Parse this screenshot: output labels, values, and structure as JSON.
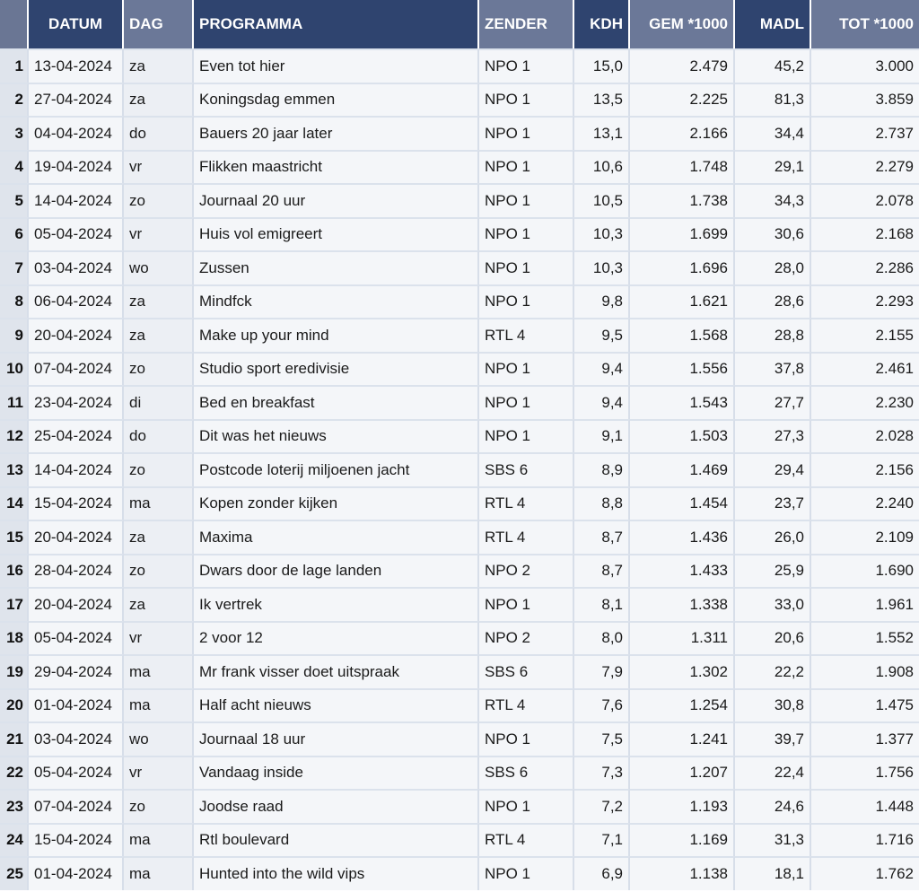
{
  "headers": {
    "rank": "",
    "datum": "DATUM",
    "dag": "DAG",
    "programma": "PROGRAMMA",
    "zender": "ZENDER",
    "kdh": "KDH",
    "gem": "GEM *1000",
    "madl": "MADL",
    "tot": "TOT *1000"
  },
  "rows": [
    {
      "rank": "1",
      "datum": "13-04-2024",
      "dag": "za",
      "programma": "Even tot hier",
      "zender": "NPO 1",
      "kdh": "15,0",
      "gem": "2.479",
      "madl": "45,2",
      "tot": "3.000"
    },
    {
      "rank": "2",
      "datum": "27-04-2024",
      "dag": "za",
      "programma": "Koningsdag emmen",
      "zender": "NPO 1",
      "kdh": "13,5",
      "gem": "2.225",
      "madl": "81,3",
      "tot": "3.859"
    },
    {
      "rank": "3",
      "datum": "04-04-2024",
      "dag": "do",
      "programma": "Bauers 20 jaar later",
      "zender": "NPO 1",
      "kdh": "13,1",
      "gem": "2.166",
      "madl": "34,4",
      "tot": "2.737"
    },
    {
      "rank": "4",
      "datum": "19-04-2024",
      "dag": "vr",
      "programma": "Flikken maastricht",
      "zender": "NPO 1",
      "kdh": "10,6",
      "gem": "1.748",
      "madl": "29,1",
      "tot": "2.279"
    },
    {
      "rank": "5",
      "datum": "14-04-2024",
      "dag": "zo",
      "programma": "Journaal 20 uur",
      "zender": "NPO 1",
      "kdh": "10,5",
      "gem": "1.738",
      "madl": "34,3",
      "tot": "2.078"
    },
    {
      "rank": "6",
      "datum": "05-04-2024",
      "dag": "vr",
      "programma": "Huis vol emigreert",
      "zender": "NPO 1",
      "kdh": "10,3",
      "gem": "1.699",
      "madl": "30,6",
      "tot": "2.168"
    },
    {
      "rank": "7",
      "datum": "03-04-2024",
      "dag": "wo",
      "programma": "Zussen",
      "zender": "NPO 1",
      "kdh": "10,3",
      "gem": "1.696",
      "madl": "28,0",
      "tot": "2.286"
    },
    {
      "rank": "8",
      "datum": "06-04-2024",
      "dag": "za",
      "programma": "Mindfck",
      "zender": "NPO 1",
      "kdh": "9,8",
      "gem": "1.621",
      "madl": "28,6",
      "tot": "2.293"
    },
    {
      "rank": "9",
      "datum": "20-04-2024",
      "dag": "za",
      "programma": "Make up your mind",
      "zender": "RTL 4",
      "kdh": "9,5",
      "gem": "1.568",
      "madl": "28,8",
      "tot": "2.155"
    },
    {
      "rank": "10",
      "datum": "07-04-2024",
      "dag": "zo",
      "programma": "Studio sport eredivisie",
      "zender": "NPO 1",
      "kdh": "9,4",
      "gem": "1.556",
      "madl": "37,8",
      "tot": "2.461"
    },
    {
      "rank": "11",
      "datum": "23-04-2024",
      "dag": "di",
      "programma": "Bed en breakfast",
      "zender": "NPO 1",
      "kdh": "9,4",
      "gem": "1.543",
      "madl": "27,7",
      "tot": "2.230"
    },
    {
      "rank": "12",
      "datum": "25-04-2024",
      "dag": "do",
      "programma": "Dit was het nieuws",
      "zender": "NPO 1",
      "kdh": "9,1",
      "gem": "1.503",
      "madl": "27,3",
      "tot": "2.028"
    },
    {
      "rank": "13",
      "datum": "14-04-2024",
      "dag": "zo",
      "programma": "Postcode loterij miljoenen jacht",
      "zender": "SBS 6",
      "kdh": "8,9",
      "gem": "1.469",
      "madl": "29,4",
      "tot": "2.156"
    },
    {
      "rank": "14",
      "datum": "15-04-2024",
      "dag": "ma",
      "programma": "Kopen zonder kijken",
      "zender": "RTL 4",
      "kdh": "8,8",
      "gem": "1.454",
      "madl": "23,7",
      "tot": "2.240"
    },
    {
      "rank": "15",
      "datum": "20-04-2024",
      "dag": "za",
      "programma": "Maxima",
      "zender": "RTL 4",
      "kdh": "8,7",
      "gem": "1.436",
      "madl": "26,0",
      "tot": "2.109"
    },
    {
      "rank": "16",
      "datum": "28-04-2024",
      "dag": "zo",
      "programma": "Dwars door de lage landen",
      "zender": "NPO 2",
      "kdh": "8,7",
      "gem": "1.433",
      "madl": "25,9",
      "tot": "1.690"
    },
    {
      "rank": "17",
      "datum": "20-04-2024",
      "dag": "za",
      "programma": "Ik vertrek",
      "zender": "NPO 1",
      "kdh": "8,1",
      "gem": "1.338",
      "madl": "33,0",
      "tot": "1.961"
    },
    {
      "rank": "18",
      "datum": "05-04-2024",
      "dag": "vr",
      "programma": "2 voor 12",
      "zender": "NPO 2",
      "kdh": "8,0",
      "gem": "1.311",
      "madl": "20,6",
      "tot": "1.552"
    },
    {
      "rank": "19",
      "datum": "29-04-2024",
      "dag": "ma",
      "programma": "Mr frank visser doet uitspraak",
      "zender": "SBS 6",
      "kdh": "7,9",
      "gem": "1.302",
      "madl": "22,2",
      "tot": "1.908"
    },
    {
      "rank": "20",
      "datum": "01-04-2024",
      "dag": "ma",
      "programma": "Half acht nieuws",
      "zender": "RTL 4",
      "kdh": "7,6",
      "gem": "1.254",
      "madl": "30,8",
      "tot": "1.475"
    },
    {
      "rank": "21",
      "datum": "03-04-2024",
      "dag": "wo",
      "programma": "Journaal 18 uur",
      "zender": "NPO 1",
      "kdh": "7,5",
      "gem": "1.241",
      "madl": "39,7",
      "tot": "1.377"
    },
    {
      "rank": "22",
      "datum": "05-04-2024",
      "dag": "vr",
      "programma": "Vandaag inside",
      "zender": "SBS 6",
      "kdh": "7,3",
      "gem": "1.207",
      "madl": "22,4",
      "tot": "1.756"
    },
    {
      "rank": "23",
      "datum": "07-04-2024",
      "dag": "zo",
      "programma": "Joodse raad",
      "zender": "NPO 1",
      "kdh": "7,2",
      "gem": "1.193",
      "madl": "24,6",
      "tot": "1.448"
    },
    {
      "rank": "24",
      "datum": "15-04-2024",
      "dag": "ma",
      "programma": "Rtl boulevard",
      "zender": "RTL 4",
      "kdh": "7,1",
      "gem": "1.169",
      "madl": "31,3",
      "tot": "1.716"
    },
    {
      "rank": "25",
      "datum": "01-04-2024",
      "dag": "ma",
      "programma": "Hunted into the wild vips",
      "zender": "NPO 1",
      "kdh": "6,9",
      "gem": "1.138",
      "madl": "18,1",
      "tot": "1.762"
    }
  ]
}
